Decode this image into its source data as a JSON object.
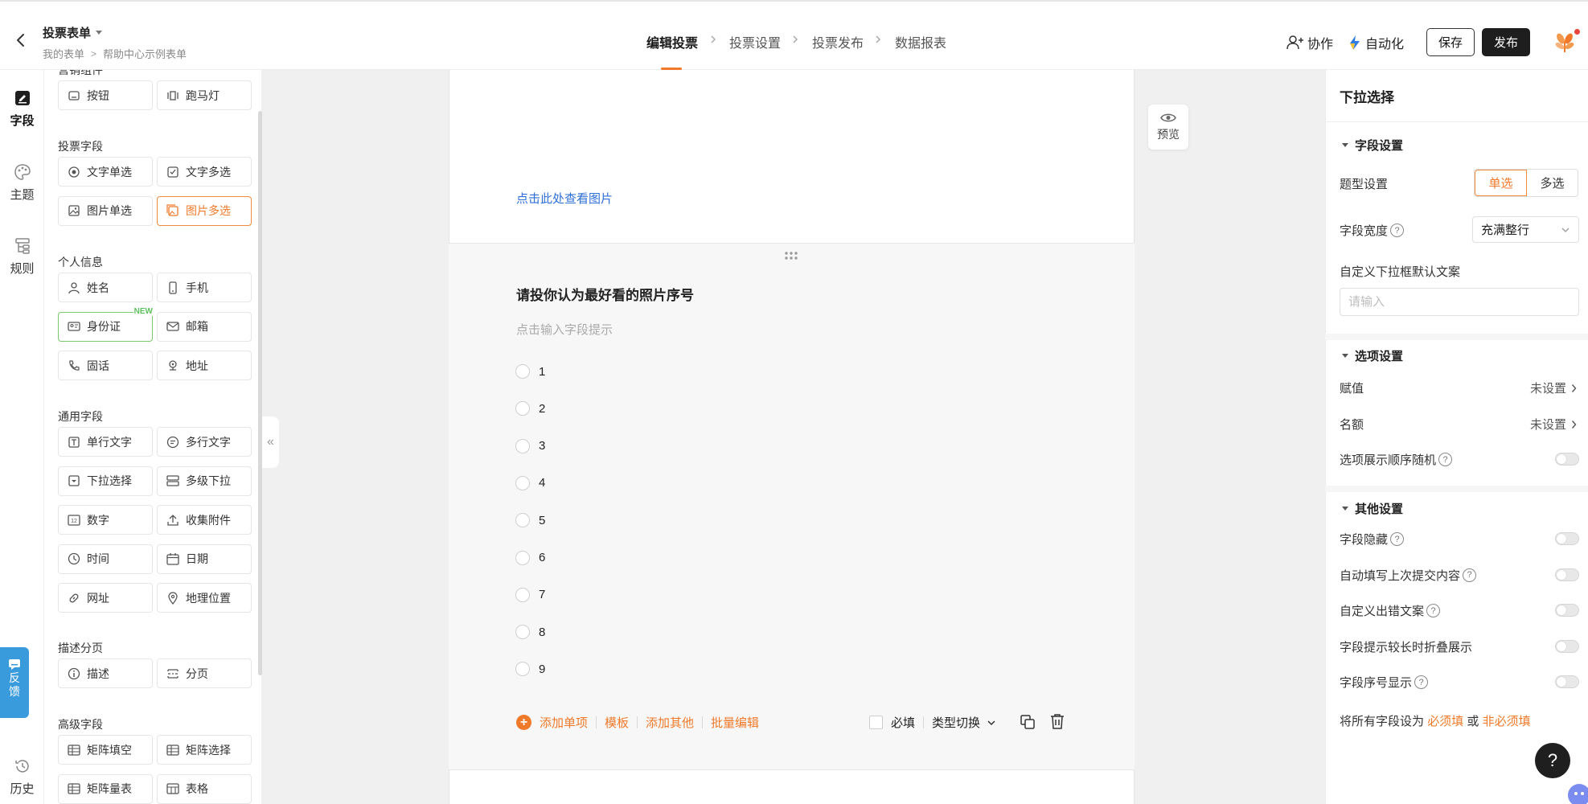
{
  "header": {
    "form_title": "投票表单",
    "breadcrumb": [
      "我的表单",
      "帮助中心示例表单"
    ],
    "steps": [
      {
        "label": "编辑投票",
        "active": true
      },
      {
        "label": "投票设置",
        "active": false
      },
      {
        "label": "投票发布",
        "active": false
      },
      {
        "label": "数据报表",
        "active": false
      }
    ],
    "collab_label": "协作",
    "automation_label": "自动化",
    "save_label": "保存",
    "publish_label": "发布"
  },
  "rail": {
    "fields": "字段",
    "theme": "主题",
    "rules": "规则",
    "history": "历史",
    "feedback": "反馈"
  },
  "components": {
    "sections": [
      {
        "title": "营销组件",
        "items": [
          {
            "label": "按钮",
            "icon": "button-icon"
          },
          {
            "label": "跑马灯",
            "icon": "marquee-icon"
          }
        ]
      },
      {
        "title": "投票字段",
        "items": [
          {
            "label": "文字单选",
            "icon": "radio-icon"
          },
          {
            "label": "文字多选",
            "icon": "checkbox-icon"
          },
          {
            "label": "图片单选",
            "icon": "image-icon"
          },
          {
            "label": "图片多选",
            "icon": "images-icon",
            "selected": true
          }
        ]
      },
      {
        "title": "个人信息",
        "items": [
          {
            "label": "姓名",
            "icon": "person-icon"
          },
          {
            "label": "手机",
            "icon": "phone-icon"
          },
          {
            "label": "身份证",
            "icon": "idcard-icon",
            "badge": "NEW"
          },
          {
            "label": "邮箱",
            "icon": "mail-icon"
          },
          {
            "label": "固话",
            "icon": "telephone-icon"
          },
          {
            "label": "地址",
            "icon": "address-icon"
          }
        ]
      },
      {
        "title": "通用字段",
        "items": [
          {
            "label": "单行文字",
            "icon": "text-icon"
          },
          {
            "label": "多行文字",
            "icon": "multiline-icon"
          },
          {
            "label": "下拉选择",
            "icon": "dropdown-icon"
          },
          {
            "label": "多级下拉",
            "icon": "cascade-icon"
          },
          {
            "label": "数字",
            "icon": "number-icon"
          },
          {
            "label": "收集附件",
            "icon": "upload-icon"
          },
          {
            "label": "时间",
            "icon": "clock-icon"
          },
          {
            "label": "日期",
            "icon": "calendar-icon"
          },
          {
            "label": "网址",
            "icon": "link-icon"
          },
          {
            "label": "地理位置",
            "icon": "location-icon"
          }
        ]
      },
      {
        "title": "描述分页",
        "items": [
          {
            "label": "描述",
            "icon": "info-icon"
          },
          {
            "label": "分页",
            "icon": "pagebreak-icon"
          }
        ]
      },
      {
        "title": "高级字段",
        "items": [
          {
            "label": "矩阵填空",
            "icon": "matrix-icon"
          },
          {
            "label": "矩阵选择",
            "icon": "matrix-icon"
          },
          {
            "label": "矩阵量表",
            "icon": "matrix-icon"
          },
          {
            "label": "表格",
            "icon": "table-icon"
          }
        ]
      }
    ]
  },
  "canvas": {
    "view_image_link": "点击此处查看图片",
    "preview_label": "预览",
    "question": {
      "title": "请投你认为最好看的照片序号",
      "hint": "点击输入字段提示",
      "options": [
        "1",
        "2",
        "3",
        "4",
        "5",
        "6",
        "7",
        "8",
        "9"
      ],
      "actions": [
        "添加单项",
        "模板",
        "添加其他",
        "批量编辑"
      ],
      "required_label": "必填",
      "type_switch_label": "类型切换"
    }
  },
  "settings": {
    "panel_title": "下拉选择",
    "field_section": "字段设置",
    "type_label": "题型设置",
    "type_options": [
      "单选",
      "多选"
    ],
    "type_selected": "单选",
    "width_label": "字段宽度",
    "width_value": "充满整行",
    "default_text_label": "自定义下拉框默认文案",
    "default_text_placeholder": "请输入",
    "options_section": "选项设置",
    "assign_label": "赋值",
    "assign_value": "未设置",
    "quota_label": "名额",
    "quota_value": "未设置",
    "random_label": "选项展示顺序随机",
    "other_section": "其他设置",
    "toggles": [
      "字段隐藏",
      "自动填写上次提交内容",
      "自定义出错文案",
      "字段提示较长时折叠展示",
      "字段序号显示"
    ],
    "bulk_prefix": "将所有字段设为",
    "bulk_required": "必须填",
    "bulk_or": "或",
    "bulk_optional": "非必须填"
  },
  "colors": {
    "accent": "#f07a2a",
    "link": "#2e6fd8",
    "feedback": "#3a9bdc",
    "primary_dark": "#1e1e1e"
  }
}
